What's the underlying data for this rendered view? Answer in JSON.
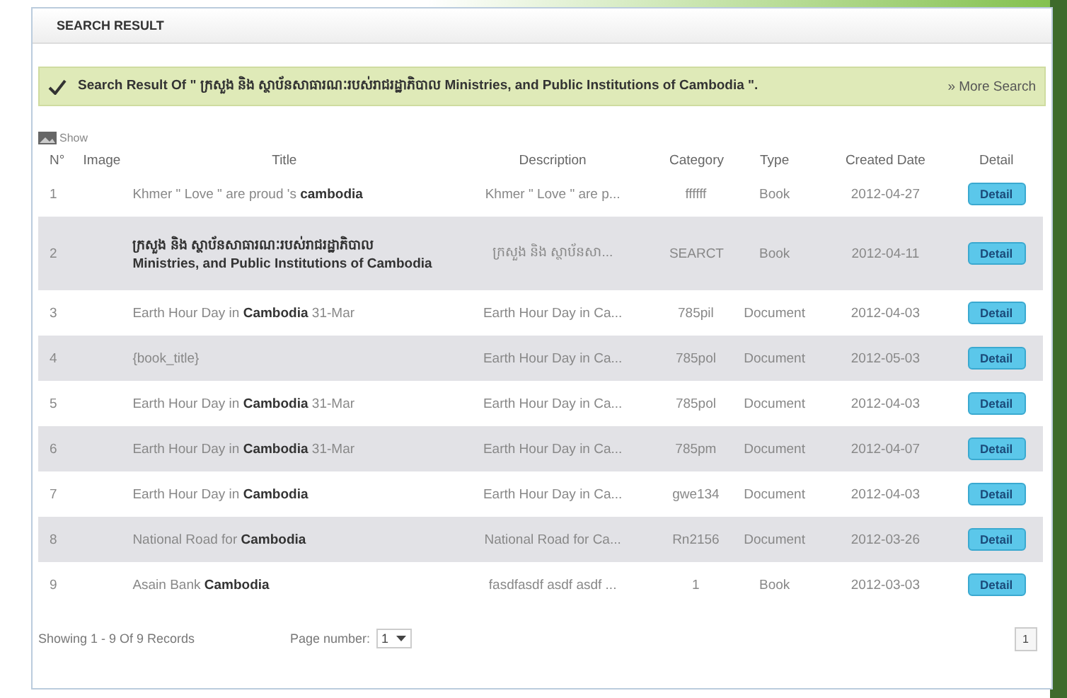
{
  "panel": {
    "title": "SEARCH RESULT"
  },
  "banner": {
    "text": "Search Result Of \" ក្រសួង និង ស្ថាប័នសាធារណៈរបស់រាជរដ្ឋាភិបាល Ministries, and Public Institutions of Cambodia \".",
    "link": "» More Search"
  },
  "show_link": "Show",
  "table": {
    "columns": [
      "N°",
      "Image",
      "Title",
      "Description",
      "Category",
      "Type",
      "Created Date",
      "Detail"
    ],
    "rows": [
      {
        "n": "1",
        "title": "Khmer \" Love \" are proud 's **cambodia**",
        "description": "Khmer \" Love \" are p...",
        "category": "ffffff",
        "type": "Book",
        "date": "2012-04-27",
        "action": "Detail"
      },
      {
        "n": "2",
        "title": "**ក្រសួង និង ស្ថាប័នសាធារណៈរបស់រាជរដ្ឋាភិបាល Ministries, and Public Institutions of Cambodia**",
        "description": "ក្រសួង និង ស្ថាប័នសា...",
        "category": "SEARCT",
        "type": "Book",
        "date": "2012-04-11",
        "action": "Detail"
      },
      {
        "n": "3",
        "title": "Earth Hour Day in **Cambodia** 31-Mar",
        "description": "Earth Hour Day in Ca...",
        "category": "785pil",
        "type": "Document",
        "date": "2012-04-03",
        "action": "Detail"
      },
      {
        "n": "4",
        "title": "{book_title}",
        "description": "Earth Hour Day in Ca...",
        "category": "785pol",
        "type": "Document",
        "date": "2012-05-03",
        "action": "Detail"
      },
      {
        "n": "5",
        "title": "Earth Hour Day in **Cambodia** 31-Mar",
        "description": "Earth Hour Day in Ca...",
        "category": "785pol",
        "type": "Document",
        "date": "2012-04-03",
        "action": "Detail"
      },
      {
        "n": "6",
        "title": "Earth Hour Day in **Cambodia** 31-Mar",
        "description": "Earth Hour Day in Ca...",
        "category": "785pm",
        "type": "Document",
        "date": "2012-04-07",
        "action": "Detail"
      },
      {
        "n": "7",
        "title": "Earth Hour Day in **Cambodia**",
        "description": "Earth Hour Day in Ca...",
        "category": "gwe134",
        "type": "Document",
        "date": "2012-04-03",
        "action": "Detail"
      },
      {
        "n": "8",
        "title": "National Road for **Cambodia**",
        "description": "National Road for Ca...",
        "category": "Rn2156",
        "type": "Document",
        "date": "2012-03-26",
        "action": "Detail"
      },
      {
        "n": "9",
        "title": "Asain Bank **Cambodia**",
        "description": "fasdfasdf asdf asdf ...",
        "category": "1",
        "type": "Book",
        "date": "2012-03-03",
        "action": "Detail"
      }
    ]
  },
  "footer": {
    "summary": "Showing 1 - 9 Of 9 Records",
    "page_label": "Page number:",
    "page_value": "1",
    "pages": [
      "1"
    ]
  }
}
